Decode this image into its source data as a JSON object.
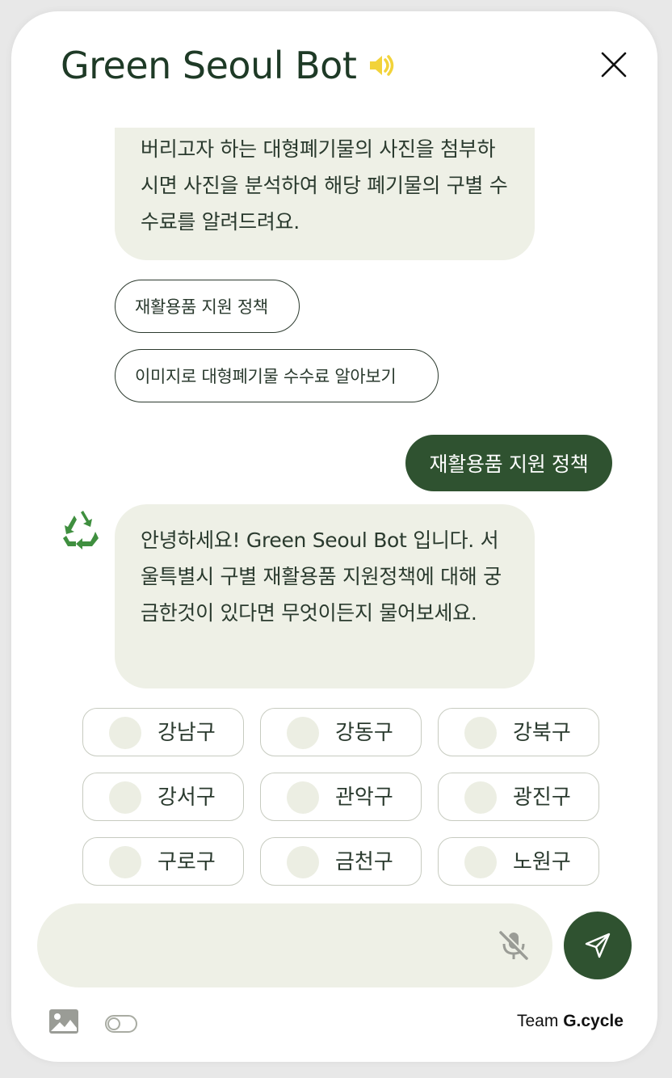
{
  "header": {
    "title": "Green Seoul Bot",
    "speaker_icon": "speaker-icon",
    "close_icon": "close-icon"
  },
  "messages": {
    "bot_image_intro": "버리고자 하는 대형폐기물의 사진을 첨부하시면 사진을 분석하여 해당 폐기물의 구별 수수료를 알려드려요.",
    "quick_replies": [
      "재활용품 지원 정책",
      "이미지로 대형폐기물 수수료 알아보기"
    ],
    "user_message": "재활용품 지원 정책",
    "bot_avatar_glyph": "♻️",
    "bot_greeting": "안녕하세요! Green Seoul Bot 입니다. 서울특별시 구별 재활용품 지원정책에 대해 궁금한것이 있다면 무엇이든지 물어보세요."
  },
  "districts": [
    "강남구",
    "강동구",
    "강북구",
    "강서구",
    "관악구",
    "광진구",
    "구로구",
    "금천구",
    "노원구"
  ],
  "input": {
    "placeholder": "",
    "value": "",
    "mic_icon": "mic-off-icon",
    "send_icon": "send-icon"
  },
  "footer": {
    "image_icon": "image-icon",
    "toggle_icon": "toggle-icon",
    "team_prefix": "Team",
    "team_name": "G.cycle"
  },
  "colors": {
    "primary_green": "#2f5230",
    "bubble_bg": "#eef0e6",
    "title_green": "#1e3a26",
    "speaker_yellow": "#f2d33a"
  }
}
